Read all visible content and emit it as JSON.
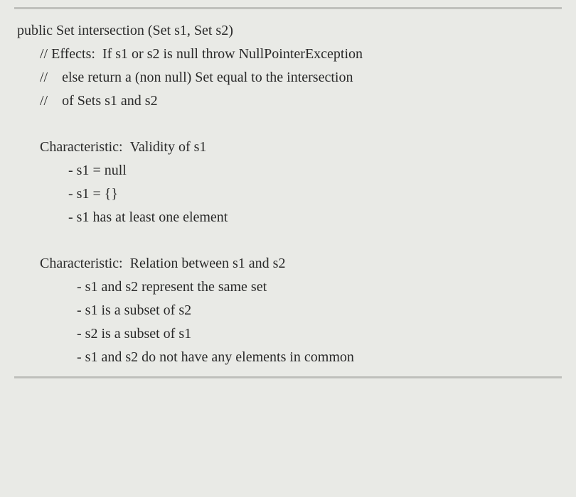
{
  "signature": "public Set intersection (Set s1, Set s2)",
  "comments": {
    "line1_prefix": "// Effects:",
    "line1_text": "If s1 or s2 is null throw NullPointerException",
    "line2_prefix": "//",
    "line2_text": "else return a (non null) Set equal to the intersection",
    "line3_prefix": "//",
    "line3_text": "of Sets s1 and s2"
  },
  "section1": {
    "label": "Characteristic:",
    "title": "Validity of s1",
    "items": [
      "- s1 = null",
      "- s1 = {}",
      "- s1 has at least one element"
    ]
  },
  "section2": {
    "label": "Characteristic:",
    "title": "Relation between s1 and s2",
    "items": [
      "- s1 and s2 represent the same set",
      "- s1 is a subset of s2",
      "- s2 is a subset of s1",
      "- s1 and s2 do not have any elements in common"
    ]
  }
}
